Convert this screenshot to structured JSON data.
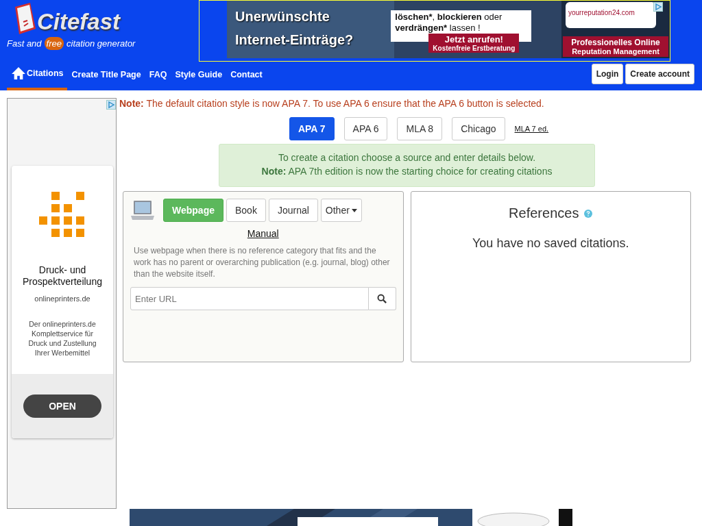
{
  "header": {
    "logo": "Citefast",
    "tagline": {
      "before": "Fast and",
      "badge": "free",
      "after": "citation generator"
    }
  },
  "top_ad": {
    "headline": [
      "Unerwünschte",
      "Internet-Einträge?"
    ],
    "offer": [
      [
        {
          "text": "löschen*",
          "bold": true
        },
        {
          "text": ", ",
          "bold": false
        },
        {
          "text": "blockieren",
          "bold": true
        },
        {
          "text": " oder",
          "bold": false
        }
      ],
      [
        {
          "text": "verdrängen*",
          "bold": true
        },
        {
          "text": " lassen !",
          "bold": false
        }
      ]
    ],
    "call": [
      "Jetzt anrufen!",
      "Kostenfreie Erstberatung"
    ],
    "brand": "yourreputation24.com",
    "slogan": [
      "Professionelles Online",
      "Reputation Management"
    ]
  },
  "nav": {
    "items": [
      {
        "label": "Citations",
        "selected": true,
        "kind": "home"
      },
      {
        "label": "Create Title Page",
        "selected": false,
        "kind": "plain"
      },
      {
        "label": "FAQ",
        "selected": false,
        "kind": "plain"
      },
      {
        "label": "Style Guide",
        "selected": false,
        "kind": "plain"
      },
      {
        "label": "Contact",
        "selected": false,
        "kind": "plain"
      }
    ],
    "buttons": [
      "Login",
      "Create account"
    ]
  },
  "side_ad": {
    "title": "Druck- und Prospektverteilung",
    "domain": "onlineprinters.de",
    "description": "Der onlineprinters.de Komplettservice für Druck und Zustellung Ihrer Werbemittel",
    "button": "OPEN"
  },
  "note": "**Note:** The default citation style is now APA 7. To use APA 6 ensure that the APA 6 button is selected.",
  "styles": [
    {
      "label": "APA 7",
      "selected": true
    },
    {
      "label": "APA 6",
      "selected": false
    },
    {
      "label": "MLA 8",
      "selected": false
    },
    {
      "label": "Chicago",
      "selected": false
    }
  ],
  "style_link": "MLA 7 ed.",
  "info": [
    "To create a citation choose a source and enter details below.",
    "**Note:** APA 7th edition is now the starting choice for creating citations"
  ],
  "source": {
    "tabs": [
      {
        "label": "Webpage",
        "selected": true,
        "kind": "tab"
      },
      {
        "label": "Book",
        "selected": false,
        "kind": "tab"
      },
      {
        "label": "Journal",
        "selected": false,
        "kind": "tab"
      },
      {
        "label": "Other",
        "selected": false,
        "kind": "dropdown"
      }
    ],
    "manual": "Manual",
    "description": "Use webpage when there is no reference category that fits and the work has no parent or overarching publication (e.g. journal, blog) other than the website itself.",
    "url": {
      "placeholder": "Enter URL"
    }
  },
  "references": {
    "title": "References",
    "empty": "You have no saved citations."
  }
}
